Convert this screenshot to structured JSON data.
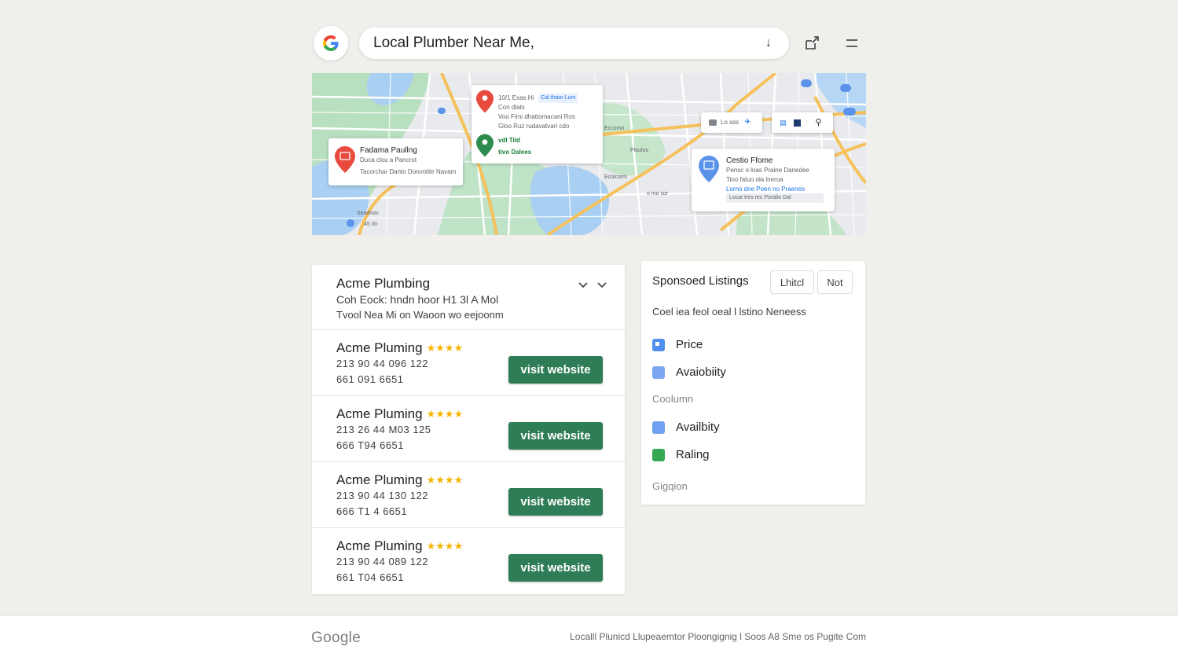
{
  "header": {
    "search_value": "Local Plumber Near Me,",
    "search_arrow": "↓",
    "logo_letter": "G"
  },
  "map": {
    "card_left": {
      "title": "Fadama Paullng",
      "line1": "Duca clou a Pancrot",
      "line2": "Tacorchar Danto Donvotite Navam"
    },
    "card_center": {
      "line1": "10/1 Exas Hi",
      "chip": "Cal thaor Lum",
      "line2": "Con dlats",
      "line3": "Voo Fimi dhattomacani Ros",
      "line4": "Gloo Ruz rudavatvari cdo",
      "green1": "vdl Tild",
      "green2": "tivo Dalees"
    },
    "card_right": {
      "title": "Cestio Ffome",
      "line1": "Pensc o lnas Praine Danedee",
      "line2": "Tino fatuo ola lneroa",
      "line3": "Lorno dne Poen no Praenes",
      "footer": "Locat tres rec Poralio Dal"
    },
    "toolbar": {
      "text": "Lo sss"
    },
    "labels": {
      "label_a": "Eccomo",
      "label_b": "Plaulos",
      "label_c": "Seadnos",
      "label_d": "o mo sor",
      "label_e": "Ecolcomt",
      "label_f": "45 dn"
    },
    "colors": {
      "water": "#a9cff3",
      "park": "#b9dfc1",
      "road": "#f6c15b"
    }
  },
  "results": {
    "header": {
      "title": "Acme Plumbing",
      "sub1": "Coh Eock: hndn hoor H1 3l A Mol",
      "sub2": "Tvool Nea Mi on Waoon wo eejoonm"
    },
    "button_label": "visit website",
    "items": [
      {
        "name": "Acme Pluming",
        "stars": "★★★★",
        "line1": "213 90 44  096 122",
        "line2": "661   091 6651"
      },
      {
        "name": "Acme Pluming",
        "stars": "★★★★",
        "line1": "213 26 44  M03 125",
        "line2": "666   T94 6651"
      },
      {
        "name": "Acme Pluming",
        "stars": "★★★★",
        "line1": "213 90 44  130 122",
        "line2": "666   T1 4 6651"
      },
      {
        "name": "Acme Pluming",
        "stars": "★★★★",
        "line1": "213 90 44  089 122",
        "line2": "661   T04 6651"
      }
    ]
  },
  "sponsored": {
    "title": "Sponsoed Listings",
    "btn_a": "Lhitcl",
    "btn_b": "Not",
    "desc": "Coel iea feol oeal l lstino Neneess",
    "options_a": [
      {
        "label": "Price",
        "color": "#4f8ff0"
      },
      {
        "label": "Avaiobiity",
        "color": "#7aa6f2"
      }
    ],
    "section_a": "Coolumn",
    "options_b": [
      {
        "label": "Availbity",
        "color": "#6fa0f1"
      },
      {
        "label": "Raling",
        "color": "#34a853"
      }
    ],
    "section_b": "Gigqion"
  },
  "footer": {
    "logo": "Google",
    "links": "Localll Plunicd Llupeaemtor Ploongignig l Soos A8 Sme os Pugite Com"
  }
}
